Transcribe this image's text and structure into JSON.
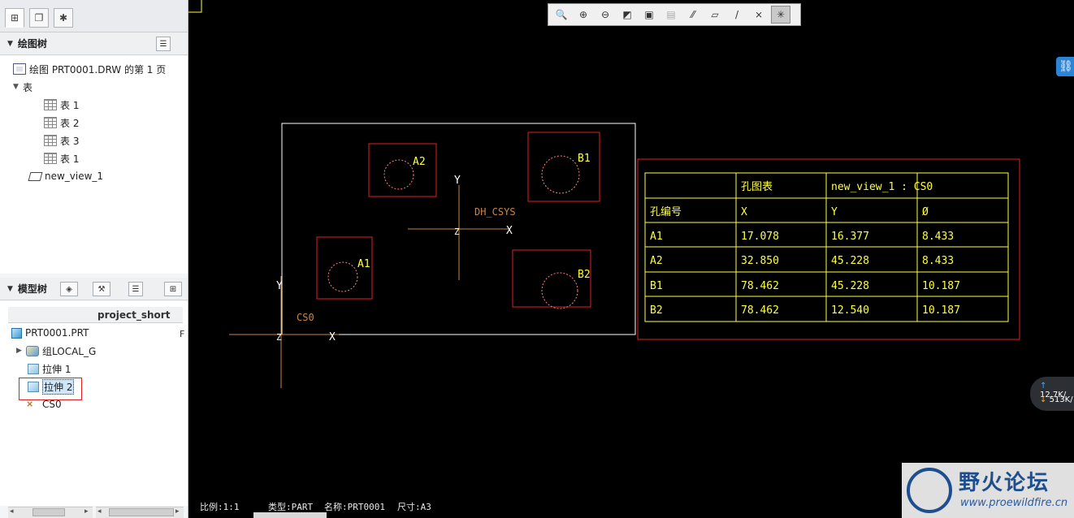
{
  "drawing_tree": {
    "title": "绘图树",
    "root": "绘图 PRT0001.DRW 的第 1 页",
    "tables_group": "表",
    "tables": [
      "表 1",
      "表 2",
      "表 3",
      "表 1"
    ],
    "view": "new_view_1"
  },
  "model_tree": {
    "title": "模型树",
    "column": "project_short",
    "col_value": "F",
    "items": [
      {
        "label": "PRT0001.PRT",
        "icon": "part-icon"
      },
      {
        "label": "组LOCAL_G",
        "icon": "group-icon"
      },
      {
        "label": "拉伸 1",
        "icon": "extrude-icon"
      },
      {
        "label": "拉伸 2",
        "icon": "extrude-icon",
        "selected": true
      },
      {
        "label": "CS0",
        "icon": "csys-icon"
      }
    ]
  },
  "toolbar": {
    "tools": [
      "zoom-fit-icon",
      "zoom-in-icon",
      "zoom-out-icon",
      "repaint-icon",
      "display-style-icon",
      "saved-views-icon",
      "datum-display-icon",
      "plane-display-icon",
      "axis-display-icon",
      "point-display-icon",
      "csys-display-icon"
    ]
  },
  "drawing": {
    "holes": [
      {
        "label": "A2"
      },
      {
        "label": "B1"
      },
      {
        "label": "A1"
      },
      {
        "label": "B2"
      }
    ],
    "csys_label": "DH_CSYS",
    "cs0_label": "CS0",
    "axis_y": "Y",
    "axis_x": "X",
    "axis_z": "Z"
  },
  "hole_table": {
    "header1": [
      "",
      "孔图表",
      "new_view_1 : CS0",
      ""
    ],
    "header2": [
      "孔编号",
      "X",
      "Y",
      "Ø"
    ],
    "rows": [
      [
        "A1",
        "17.078",
        "16.377",
        "8.433"
      ],
      [
        "A2",
        "32.850",
        "45.228",
        "8.433"
      ],
      [
        "B1",
        "78.462",
        "45.228",
        "10.187"
      ],
      [
        "B2",
        "78.462",
        "12.540",
        "10.187"
      ]
    ]
  },
  "status": {
    "scale": "比例:1:1",
    "type": "类型:PART",
    "name": "名称:PRT0001",
    "size": "尺寸:A3"
  },
  "net": {
    "up": "12.7K/",
    "down": "513K/"
  },
  "watermark": {
    "title": "野火论坛",
    "url": "www.proewildfire.cn"
  },
  "colors": {
    "white": "#ffffff",
    "red": "#e02020",
    "yellow": "#ffff40",
    "orange": "#c8864a"
  }
}
